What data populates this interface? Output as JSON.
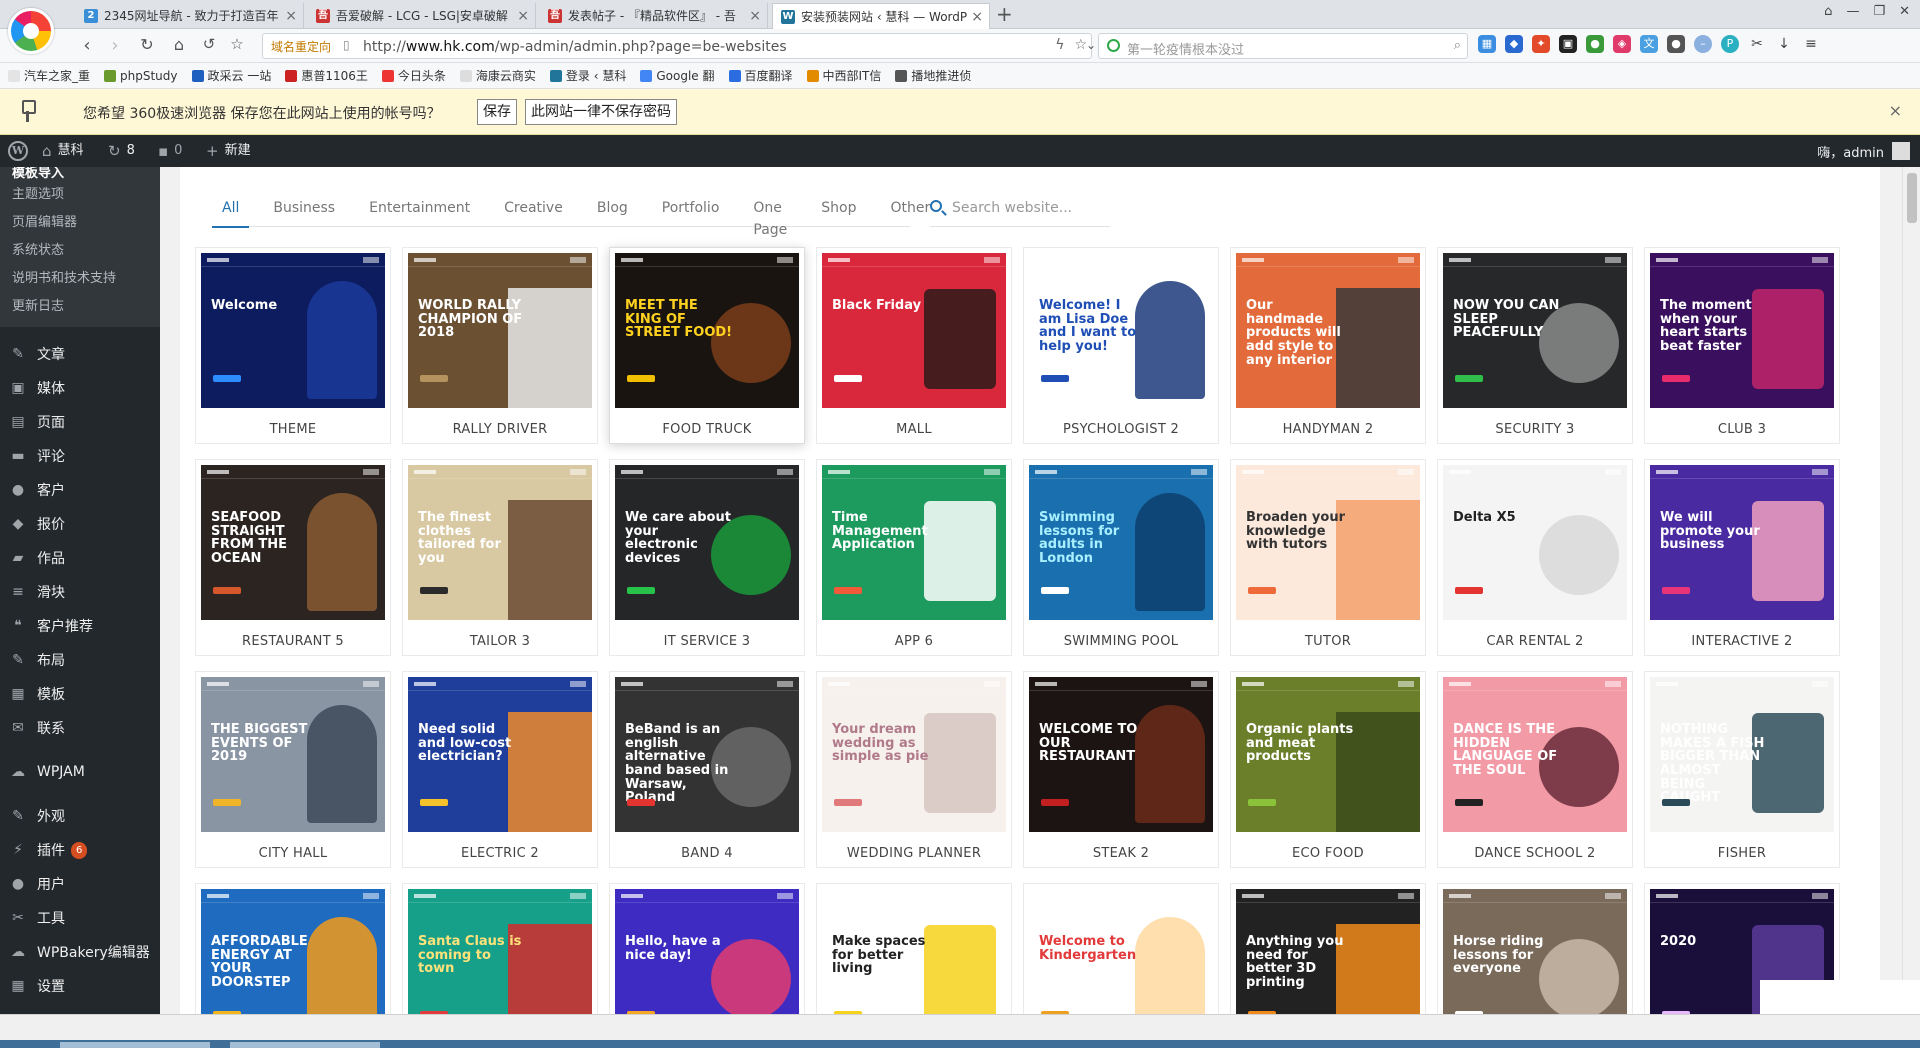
{
  "browser": {
    "tabs": [
      {
        "title": "2345网址导航 - 致力于打造百年",
        "color": "#3b8fd6",
        "glyph": "2"
      },
      {
        "title": "吾爱破解 - LCG - LSG|安卓破解",
        "color": "#cc3333",
        "glyph": "吾"
      },
      {
        "title": "发表帖子 - 『精品软件区』 - 吾",
        "color": "#cc3333",
        "glyph": "吾"
      },
      {
        "title": "安装预装网站 ‹ 慧科 — WordP",
        "color": "#21759b",
        "glyph": "W"
      }
    ],
    "new_tab": "+",
    "url_badge": "域名重定向",
    "url_prefix": "http://",
    "url_host": "www.hk.com",
    "url_path": "/wp-admin/admin.php?page=be-websites",
    "search_placeholder": "第一轮疫情根本没过",
    "window_controls": [
      "⌂",
      "—",
      "❐",
      "✕"
    ]
  },
  "bookmarks": [
    {
      "label": "汽车之家_重",
      "color": "#e4e4e4"
    },
    {
      "label": "phpStudy",
      "color": "#6a9a2d"
    },
    {
      "label": "政采云 一站",
      "color": "#1f5fbf"
    },
    {
      "label": "惠普1106王",
      "color": "#c22"
    },
    {
      "label": "今日头条",
      "color": "#e33"
    },
    {
      "label": "海康云商实",
      "color": "#ddd"
    },
    {
      "label": "登录 ‹ 慧科",
      "color": "#21759b"
    },
    {
      "label": "Google 翻",
      "color": "#4285f4"
    },
    {
      "label": "百度翻译",
      "color": "#2b6de0"
    },
    {
      "label": "中西部IT信",
      "color": "#e28a00"
    },
    {
      "label": "播地推进侦",
      "color": "#555"
    }
  ],
  "password_bar": {
    "message": "您希望 360极速浏览器 保存您在此网站上使用的帐号吗？",
    "save_label": "保存",
    "never_label": "此网站一律不保存密码",
    "close": "×"
  },
  "adminbar": {
    "site_name": "慧科",
    "updates": "8",
    "comments": "0",
    "new_label": "新建",
    "greeting": "嗨，admin"
  },
  "sidebar": {
    "submenu": [
      {
        "label": "模板导入",
        "current": true
      },
      {
        "label": "主题选项"
      },
      {
        "label": "页眉编辑器"
      },
      {
        "label": "系统状态"
      },
      {
        "label": "说明书和技术支持"
      },
      {
        "label": "更新日志"
      }
    ],
    "menu": [
      {
        "label": "文章",
        "icon": "✎"
      },
      {
        "label": "媒体",
        "icon": "▣"
      },
      {
        "label": "页面",
        "icon": "▤"
      },
      {
        "label": "评论",
        "icon": "▬"
      },
      {
        "label": "客户",
        "icon": "●"
      },
      {
        "label": "报价",
        "icon": "◆"
      },
      {
        "label": "作品",
        "icon": "▰"
      },
      {
        "label": "滑块",
        "icon": "≡"
      },
      {
        "label": "客户推荐",
        "icon": "❝"
      },
      {
        "label": "布局",
        "icon": "✎"
      },
      {
        "label": "模板",
        "icon": "▦"
      },
      {
        "label": "联系",
        "icon": "✉"
      },
      {
        "label": "WPJAM",
        "icon": "☁",
        "sep_before": true
      },
      {
        "label": "外观",
        "icon": "✎",
        "sep_before": true
      },
      {
        "label": "插件",
        "icon": "⚡",
        "badge": "6"
      },
      {
        "label": "用户",
        "icon": "●"
      },
      {
        "label": "工具",
        "icon": "✂"
      },
      {
        "label": "WPBakery编辑器",
        "icon": "☁"
      },
      {
        "label": "设置",
        "icon": "▦"
      }
    ]
  },
  "filters": [
    "All",
    "Business",
    "Entertainment",
    "Creative",
    "Blog",
    "Portfolio",
    "One Page",
    "Shop",
    "Other"
  ],
  "search_placeholder": "Search website...",
  "websites": [
    {
      "name": "THEME",
      "bg": "#0d1c5e",
      "fg": "#ffffff",
      "headline": "Welcome",
      "accent": "#2d8cff",
      "pic": "#1b3a9a"
    },
    {
      "name": "RALLY DRIVER",
      "bg": "#6b5132",
      "fg": "#ffffff",
      "headline": "WORLD RALLY CHAMPION OF 2018",
      "accent": "#b5935f",
      "pic": "#e8e8e8"
    },
    {
      "name": "FOOD TRUCK",
      "bg": "#1a1410",
      "fg": "#ffd21f",
      "headline": "MEET THE KING OF STREET FOOD!",
      "accent": "#f0c000",
      "pic": "#7a3d1a",
      "hover": true
    },
    {
      "name": "MALL",
      "bg": "#d9283c",
      "fg": "#ffffff",
      "headline": "Black Friday",
      "accent": "#ffffff",
      "pic": "#2b1a1a"
    },
    {
      "name": "PSYCHOLOGIST 2",
      "bg": "#ffffff",
      "fg": "#1f4fb5",
      "headline": "Welcome! I am Lisa Doe and I want to help you!",
      "accent": "#1f4fb5",
      "pic": "#1c3a7a"
    },
    {
      "name": "HANDYMAN 2",
      "bg": "#e36a3a",
      "fg": "#ffffff",
      "headline": "Our handmade products will add style to any interior",
      "accent": "#e36a3a",
      "pic": "#3a3a3a"
    },
    {
      "name": "SECURITY 3",
      "bg": "#26282a",
      "fg": "#ffffff",
      "headline": "NOW YOU CAN SLEEP PEACEFULLY",
      "accent": "#2fbf4a",
      "pic": "#8a8a8a"
    },
    {
      "name": "CLUB 3",
      "bg": "#3a0f5e",
      "fg": "#ffffff",
      "headline": "The moment when your heart starts beat faster",
      "accent": "#e82b6a",
      "pic": "#c2256b"
    },
    {
      "name": "RESTAURANT 5",
      "bg": "#2b2421",
      "fg": "#ffffff",
      "headline": "SEAFOOD STRAIGHT FROM THE OCEAN",
      "accent": "#d6572b",
      "pic": "#8a5a32"
    },
    {
      "name": "TAILOR 3",
      "bg": "#d8c9a2",
      "fg": "#ffffff",
      "headline": "The finest clothes tailored for you",
      "accent": "#2b2b2b",
      "pic": "#6a4a32"
    },
    {
      "name": "IT SERVICE 3",
      "bg": "#242628",
      "fg": "#ffffff",
      "headline": "We care about your electronic devices",
      "accent": "#27c24a",
      "pic": "#1a9a3a"
    },
    {
      "name": "APP 6",
      "bg": "#1d9a5e",
      "fg": "#ffffff",
      "headline": "Time Management Application",
      "accent": "#f35a3a",
      "pic": "#ffffff"
    },
    {
      "name": "SWIMMING POOL",
      "bg": "#1a6fae",
      "fg": "#a8f0ff",
      "headline": "Swimming lessons for adults in London",
      "accent": "#ffffff",
      "pic": "#0d3f6e"
    },
    {
      "name": "TUTOR",
      "bg": "#fde9dc",
      "fg": "#333333",
      "headline": "Broaden your knowledge with tutors",
      "accent": "#ef6a3a",
      "pic": "#f3a06a"
    },
    {
      "name": "CAR RENTAL 2",
      "bg": "#f4f4f4",
      "fg": "#222222",
      "headline": "Delta X5",
      "accent": "#e3342f",
      "pic": "#d8d8d8"
    },
    {
      "name": "INTERACTIVE 2",
      "bg": "#4a2aa0",
      "fg": "#ffffff",
      "headline": "We will promote your business",
      "accent": "#e8357a",
      "pic": "#f0a0c0"
    },
    {
      "name": "CITY HALL",
      "bg": "#8a95a4",
      "fg": "#ffffff",
      "headline": "THE BIGGEST EVENTS OF 2019",
      "accent": "#f0b429",
      "pic": "#3d4a5a"
    },
    {
      "name": "ELECTRIC 2",
      "bg": "#1f3d9a",
      "fg": "#ffffff",
      "headline": "Need solid and low-cost electrician?",
      "accent": "#f6c22b",
      "pic": "#f08a2a"
    },
    {
      "name": "BAND 4",
      "bg": "#333333",
      "fg": "#ffffff",
      "headline": "BeBand is an english alternative band based in Warsaw, Poland",
      "accent": "#e3342f",
      "pic": "#6a6a6a"
    },
    {
      "name": "WEDDING PLANNER",
      "bg": "#f7f1ee",
      "fg": "#b07a8a",
      "headline": "Your dream wedding as simple as pie",
      "accent": "#e07a7a",
      "pic": "#d6c6c0"
    },
    {
      "name": "STEAK 2",
      "bg": "#1c1412",
      "fg": "#ffffff",
      "headline": "WELCOME TO OUR RESTAURANT",
      "accent": "#c22020",
      "pic": "#6a2a1a"
    },
    {
      "name": "ECO FOOD",
      "bg": "#6b7f2a",
      "fg": "#ffffff",
      "headline": "Organic plants and meat products",
      "accent": "#8ac23a",
      "pic": "#3a4a1a"
    },
    {
      "name": "DANCE SCHOOL 2",
      "bg": "#f29aa6",
      "fg": "#ffffff",
      "headline": "DANCE IS THE HIDDEN LANGUAGE OF THE SOUL",
      "accent": "#222222",
      "pic": "#6a2a3a"
    },
    {
      "name": "FISHER",
      "bg": "#f4f4f2",
      "fg": "#ffffff",
      "headline": "NOTHING MAKES A FISH BIGGER THAN ALMOST BEING CAUGHT",
      "accent": "#2a4a5a",
      "pic": "#2f4e5c"
    },
    {
      "name": "",
      "bg": "#1f6bbf",
      "fg": "#ffffff",
      "headline": "AFFORDABLE ENERGY AT YOUR DOORSTEP",
      "accent": "#f2b51b",
      "pic": "#f29a1a"
    },
    {
      "name": "",
      "bg": "#16a08a",
      "fg": "#ffe27a",
      "headline": "Santa Claus is coming to town",
      "accent": "#e33b3b",
      "pic": "#d52a2a"
    },
    {
      "name": "",
      "bg": "#3d2bc2",
      "fg": "#ffffff",
      "headline": "Hello, have a nice day!",
      "accent": "#f5a623",
      "pic": "#e23c6e"
    },
    {
      "name": "",
      "bg": "#ffffff",
      "fg": "#222222",
      "headline": "Make spaces for better living",
      "accent": "#f6d21b",
      "pic": "#f6d21b"
    },
    {
      "name": "",
      "bg": "#ffffff",
      "fg": "#e23a3a",
      "headline": "Welcome to Kindergarten",
      "accent": "#f0a020",
      "pic": "#ffd9a0"
    },
    {
      "name": "",
      "bg": "#222222",
      "fg": "#ffffff",
      "headline": "Anything you need for better 3D printing",
      "accent": "#f08a1a",
      "pic": "#f08a1a"
    },
    {
      "name": "",
      "bg": "#7a6a5a",
      "fg": "#ffffff",
      "headline": "Horse riding lessons for everyone",
      "accent": "#ffffff",
      "pic": "#c8b8a8"
    },
    {
      "name": "",
      "bg": "#1a0f3a",
      "fg": "#ffffff",
      "headline": "2020",
      "accent": "#e8b8ff",
      "pic": "#5a3a9a"
    }
  ]
}
